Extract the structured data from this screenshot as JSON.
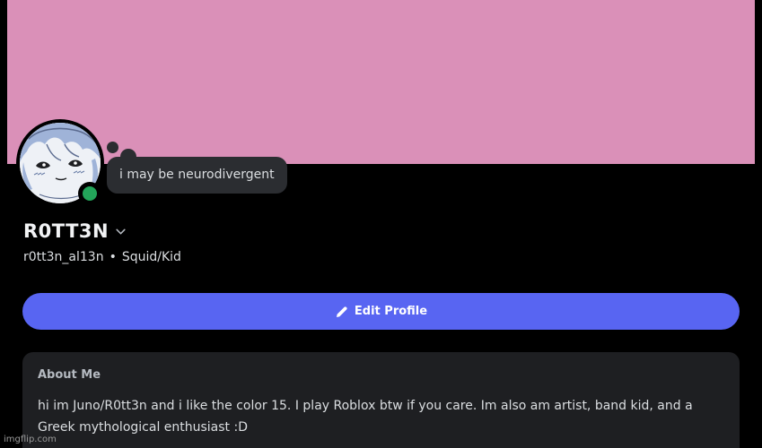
{
  "profile": {
    "banner_color": "#da90b8",
    "status_text": "i may be neurodivergent",
    "status_color": "#23a55a",
    "display_name": "R0TT3N",
    "username": "r0tt3n_al13n",
    "separator": "•",
    "pronouns": "Squid/Kid",
    "edit_button_label": "Edit Profile",
    "accent_color": "#5865f2"
  },
  "about": {
    "title": "About Me",
    "body": "hi im Juno/R0tt3n and i like the color 15. I play Roblox btw if you care. Im also am artist, band kid, and a Greek mythological enthusiast :D"
  },
  "watermark": "imgflip.com",
  "icons": {
    "chevron": "chevron-down-icon",
    "pencil": "pencil-icon",
    "status": "online-status-icon"
  }
}
